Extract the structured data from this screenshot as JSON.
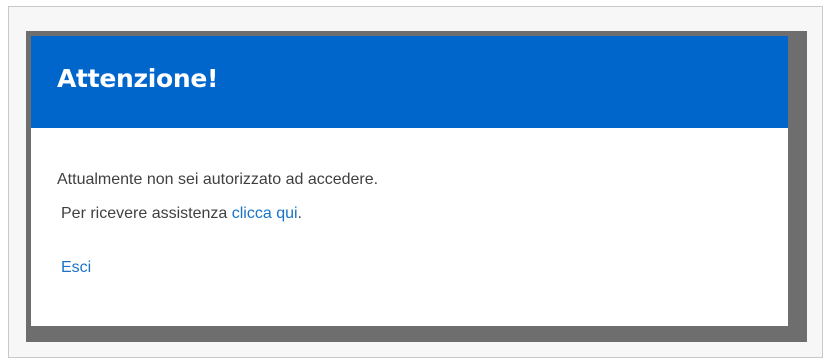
{
  "dialog": {
    "title": "Attenzione!",
    "message_line1": "Attualmente non sei autorizzato ad accedere.",
    "message_line2_prefix": "Per ricevere assistenza ",
    "help_link_label": "clicca qui",
    "message_line2_suffix": ".",
    "logout_label": "Esci"
  },
  "colors": {
    "header_background": "#0066cc",
    "link": "#1a73c6",
    "body_text": "#404040",
    "shadow": "#6e6e6e"
  }
}
